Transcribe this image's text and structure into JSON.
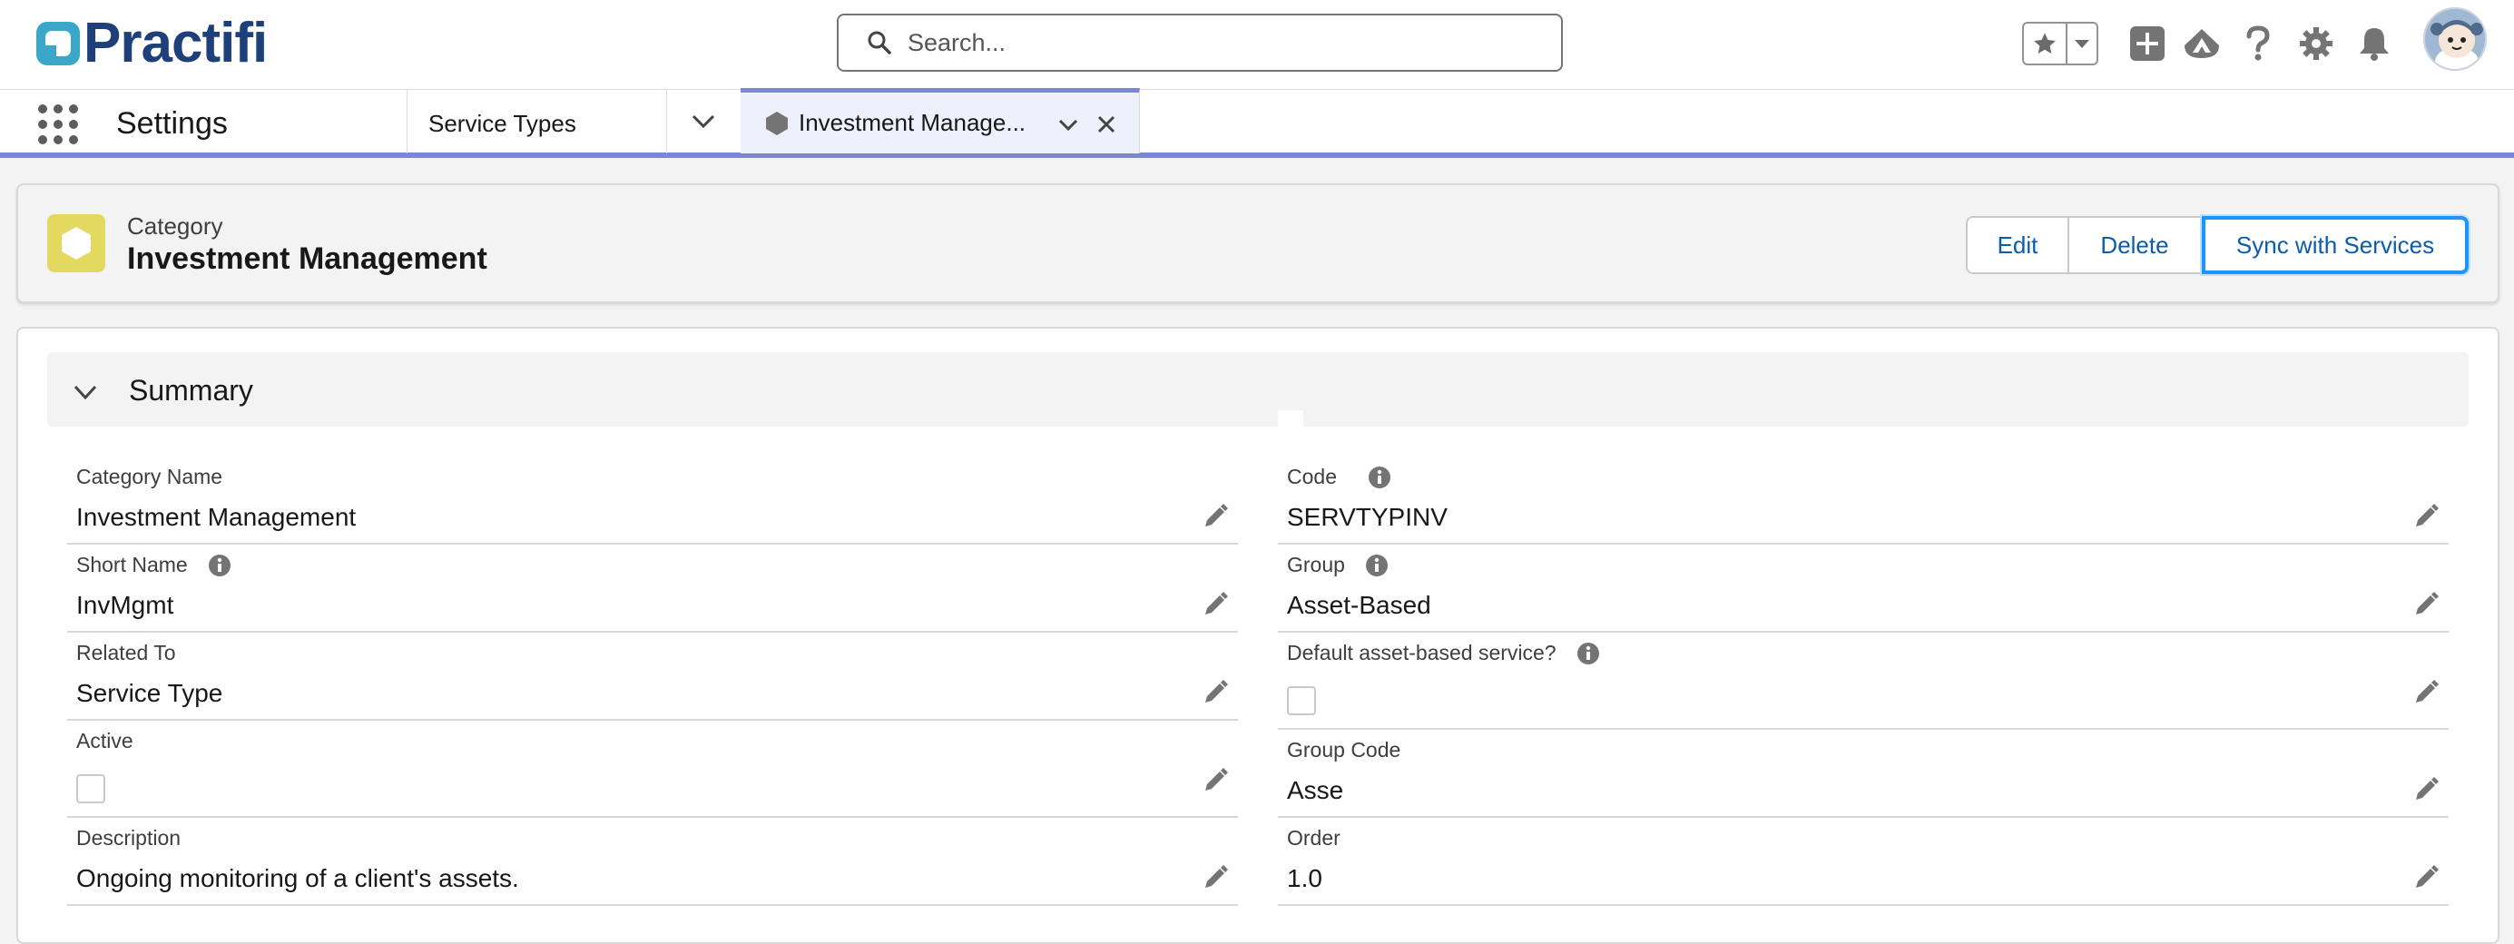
{
  "header": {
    "logo_text": "Practifi",
    "search_placeholder": "Search...",
    "brand_color": "#1d3f7a",
    "accent_teal": "#3aa7c9",
    "icons": [
      "favorites-star-icon",
      "favorites-dropdown-icon",
      "global-actions-add-icon",
      "trailhead-icon",
      "help-icon",
      "setup-gear-icon",
      "notifications-bell-icon",
      "user-avatar"
    ]
  },
  "nav": {
    "app_name": "Settings",
    "item": "Service Types",
    "active_tab": {
      "label": "Investment Manage...",
      "icon": "hexagon-icon"
    },
    "accent_color": "#7c85d6"
  },
  "record": {
    "object_type": "Category",
    "title": "Investment Management",
    "icon_color": "#e4d960",
    "buttons": {
      "edit": "Edit",
      "delete": "Delete",
      "sync": "Sync with Services"
    }
  },
  "summary": {
    "title": "Summary",
    "left_fields": [
      {
        "label": "Category Name",
        "value": "Investment Management",
        "info": false
      },
      {
        "label": "Short Name",
        "value": "InvMgmt",
        "info": true
      },
      {
        "label": "Related To",
        "value": "Service Type",
        "info": false
      },
      {
        "label": "Active",
        "type": "checkbox",
        "checked": false,
        "info": false
      },
      {
        "label": "Description",
        "value": "Ongoing monitoring of a client's assets.",
        "info": false
      }
    ],
    "right_fields": [
      {
        "label": "Code",
        "value": "SERVTYPINV",
        "info": true
      },
      {
        "label": "Group",
        "value": "Asset-Based",
        "info": true
      },
      {
        "label": "Default asset-based service?",
        "type": "checkbox",
        "checked": false,
        "info": true
      },
      {
        "label": "Group Code",
        "value": "Asse",
        "info": false
      },
      {
        "label": "Order",
        "value": "1.0",
        "info": false
      }
    ]
  }
}
